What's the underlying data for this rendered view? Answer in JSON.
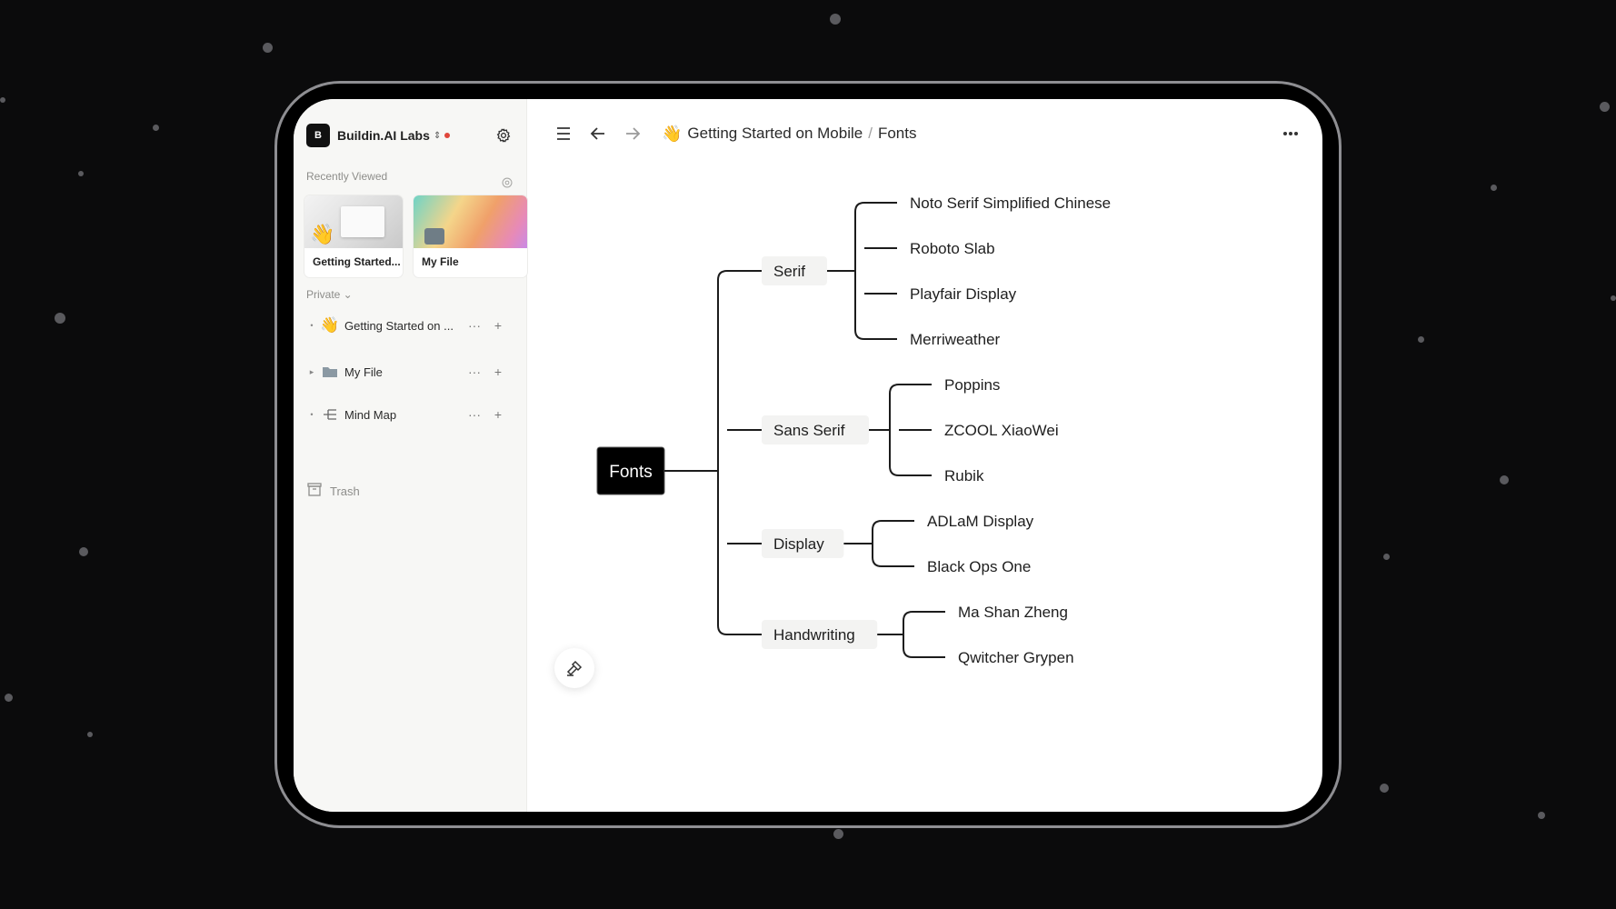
{
  "workspace": {
    "logo_letter": "B",
    "name": "Buildin.AI Labs",
    "switch_glyph": "⇕",
    "status_color": "#e0463b",
    "settings_icon": "gear-icon"
  },
  "recently_viewed": {
    "label": "Recently Viewed",
    "cards": [
      {
        "title": "Getting Started...",
        "emoji": "👋"
      },
      {
        "title": "My File"
      }
    ]
  },
  "private_section": {
    "label": "Private ⌄",
    "items": [
      {
        "label": "Getting Started on ...",
        "bullet": "•",
        "icon": "wave-emoji",
        "emoji": "👋",
        "more": "···",
        "add": "+"
      },
      {
        "label": "My File",
        "bullet": "▸",
        "icon": "folder-icon",
        "more": "···",
        "add": "+"
      },
      {
        "label": "Mind Map",
        "bullet": "•",
        "icon": "mind-map-icon",
        "more": "···",
        "add": "+"
      }
    ],
    "trash_label": "Trash"
  },
  "topbar": {
    "menu_icon": "menu-icon",
    "back_icon": "arrow-left-icon",
    "forward_icon": "arrow-right-icon",
    "breadcrumb_emoji": "👋",
    "breadcrumb_parent": "Getting Started on Mobile",
    "breadcrumb_sep": "/",
    "breadcrumb_current": "Fonts",
    "more_icon": "more-horizontal-icon"
  },
  "mind_map": {
    "root": "Fonts",
    "branches": [
      {
        "label": "Serif",
        "children": [
          "Noto Serif Simplified Chinese",
          "Roboto Slab",
          "Playfair Display",
          "Merriweather"
        ]
      },
      {
        "label": "Sans Serif",
        "children": [
          "Poppins",
          "ZCOOL XiaoWei",
          "Rubik"
        ]
      },
      {
        "label": "Display",
        "children": [
          "ADLaM Display",
          "Black Ops One"
        ]
      },
      {
        "label": "Handwriting",
        "children": [
          "Ma Shan Zheng",
          "Qwitcher Grypen"
        ]
      }
    ]
  },
  "fab_icon": "hammer-icon"
}
